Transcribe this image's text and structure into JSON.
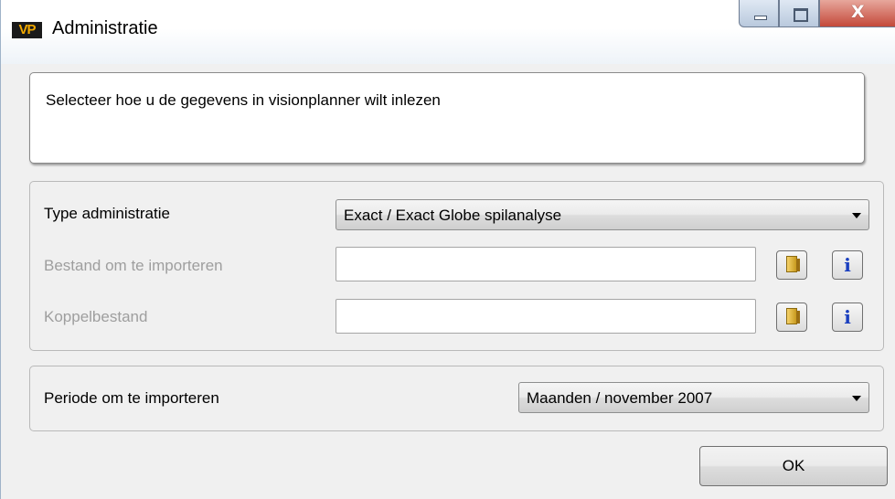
{
  "window": {
    "logo": "VP",
    "title": "Administratie"
  },
  "message": "Selecteer hoe u de gegevens in visionplanner wilt inlezen",
  "administratie": {
    "type_label": "Type administratie",
    "type_value": "Exact / Exact Globe spilanalyse",
    "bestand_label": "Bestand om te importeren",
    "bestand_value": "",
    "koppel_label": "Koppelbestand",
    "koppel_value": "",
    "info_glyph": "i"
  },
  "periode": {
    "label": "Periode om te importeren",
    "value": "Maanden / november 2007"
  },
  "ok_label": "OK",
  "controls": {
    "close_glyph": "X"
  }
}
